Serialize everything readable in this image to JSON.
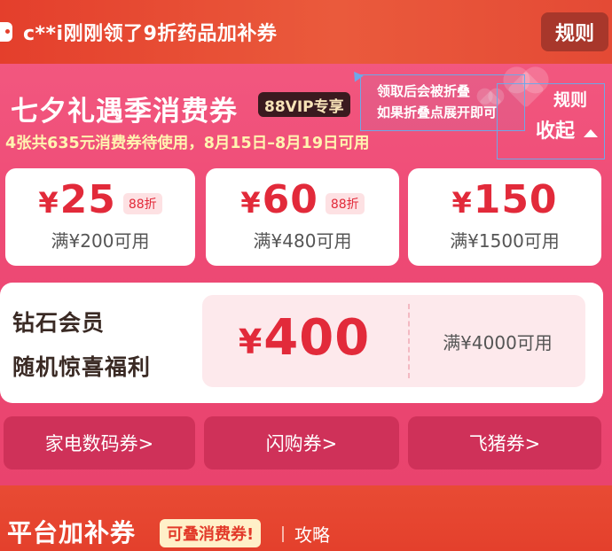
{
  "ticker": {
    "text": "c**i刚刚领了9折药品加补券",
    "icon": "ticket-icon"
  },
  "header": {
    "rules_label": "规则"
  },
  "panel": {
    "title": "七夕礼遇季消费券",
    "vip_badge": "88VIP专享",
    "subtitle": "4张共635元消费券待使用，8月15日–8月19日可用",
    "rules_label": "规则",
    "collapse_label": "收起",
    "annotation_line1": "领取后会被折叠",
    "annotation_line2": "如果折叠点展开即可"
  },
  "coupons": [
    {
      "currency": "¥",
      "amount": "25",
      "discount": "88折",
      "condition": "满¥200可用"
    },
    {
      "currency": "¥",
      "amount": "60",
      "discount": "88折",
      "condition": "满¥480可用"
    },
    {
      "currency": "¥",
      "amount": "150",
      "discount": "",
      "condition": "满¥1500可用"
    }
  ],
  "diamond": {
    "label_line1": "钻石会员",
    "label_line2": "随机惊喜福利",
    "currency": "¥",
    "amount": "400",
    "condition": "满¥4000可用"
  },
  "categories": [
    {
      "label": "家电数码券>"
    },
    {
      "label": "闪购券>"
    },
    {
      "label": "飞猪券>"
    }
  ],
  "bottom": {
    "title": "平台加补券",
    "badge": "可叠消费券!",
    "guide": "攻略"
  },
  "colors": {
    "brand_red": "#e43f2c",
    "panel_pink": "#ee4a75",
    "price_red": "#e22a3a",
    "category_bg": "#cf3159",
    "annotation_blue": "#6ea8e8"
  }
}
